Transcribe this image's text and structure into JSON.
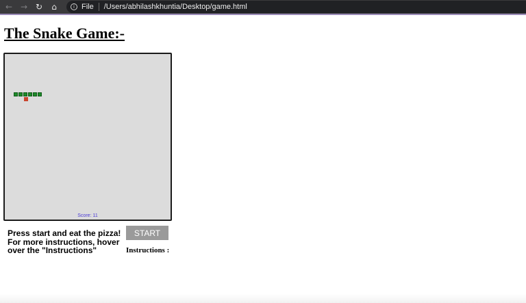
{
  "browser": {
    "scheme_label": "File",
    "path": "/Users/abhilashkhuntia/Desktop/game.html",
    "icons": [
      "back-icon",
      "forward-icon",
      "reload-icon",
      "home-icon",
      "info-icon"
    ]
  },
  "page": {
    "title": "The Snake Game:-"
  },
  "game": {
    "score_text": "Score: 11",
    "snake_color": "#1f8a2a",
    "food_color": "#c9452d",
    "board_color": "#dcdcdc"
  },
  "controls": {
    "help_line1": "Press start and eat the pizza!",
    "help_line2": "For more instructions, hover over the \"Instructions\"",
    "start_label": "START",
    "instructions_label": "Instructions :"
  }
}
